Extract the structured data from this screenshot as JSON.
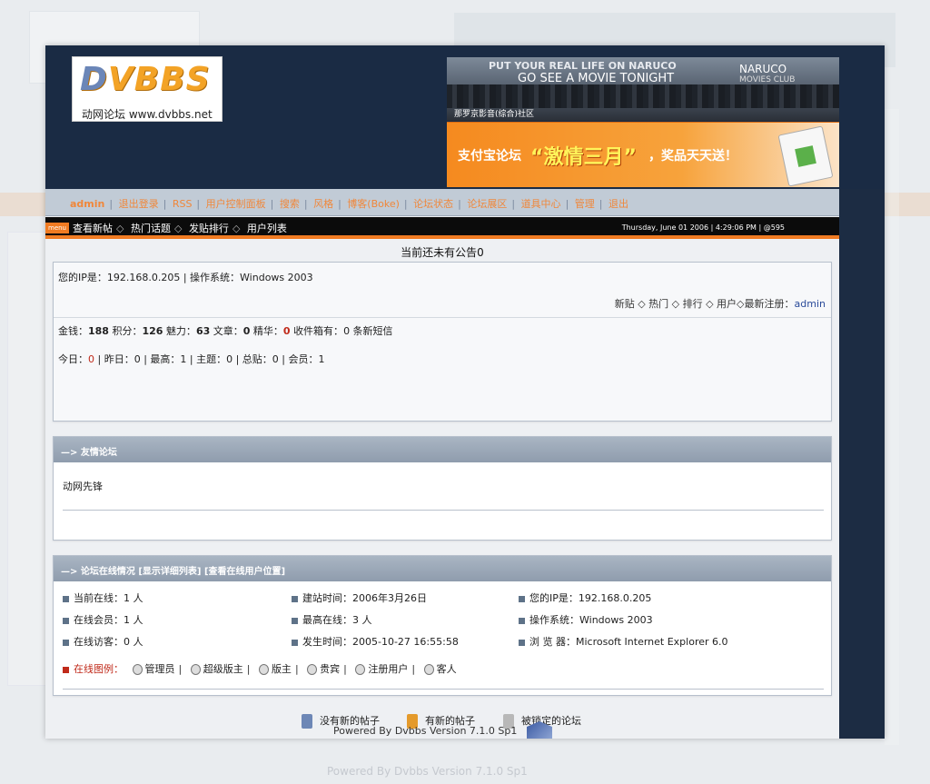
{
  "logo": {
    "mark_d": "D",
    "mark_rest": "VBBS",
    "caption": "动网论坛 www.dvbbs.net"
  },
  "banner_top": {
    "line1": "PUT YOUR REAL LIFE ON NARUCO",
    "line2": "GO SEE A MOVIE TONIGHT",
    "brand": "NARUCO",
    "brand_sub": "MOVIES CLUB",
    "community": "那罗京影音(综合)社区"
  },
  "banner_bottom": {
    "part1": "支付宝论坛",
    "part2": "“激情三月”",
    "part3": "，奖品天天送！"
  },
  "navbar1": {
    "items": [
      "admin",
      "退出登录",
      "RSS",
      "用户控制面板",
      "搜索",
      "风格",
      "博客(Boke)",
      "论坛状态",
      "论坛展区",
      "道具中心",
      "管理",
      "退出"
    ]
  },
  "navbar2": {
    "menu_tag": "menu",
    "links": [
      "查看新帖",
      "热门话题",
      "发贴排行",
      "用户列表"
    ],
    "date": "Thursday, June 01 2006 | 4:29:06 PM | @595"
  },
  "notice": "当前还未有公告0",
  "user_panel": {
    "ip_text": "您的IP是：192.168.0.205 | 操作系统：Windows 2003",
    "right_links": "新贴 ◇ 热门 ◇ 排行 ◇ 用户◇最新注册：",
    "latest_user": "admin",
    "money_label": "金钱：",
    "money": "188",
    "points_label": " 积分：",
    "points": "126",
    "charm_label": " 魅力：",
    "charm": "63",
    "posts_label": " 文章：",
    "posts": "0",
    "elite_label": " 精华：",
    "elite": "0",
    "inbox_label": " 收件箱有：",
    "inbox": "0",
    "inbox_suffix": " 条新短信",
    "today_label": "今日：",
    "today": "0",
    "stats_rest": " | 昨日：0 | 最高：1 | 主题：0 | 总贴：0 | 会员：1"
  },
  "links_panel": {
    "title": "—> 友情论坛",
    "body": "动网先锋"
  },
  "online_panel": {
    "title": "—> 论坛在线情况 [显示详细列表] [查看在线用户位置]",
    "col1": [
      "当前在线：1 人",
      "在线会员：1 人",
      "在线访客：0 人"
    ],
    "col2": [
      "建站时间：2006年3月26日",
      "最高在线：3 人",
      "发生时间：2005-10-27 16:55:58"
    ],
    "col3": [
      "您的IP是：192.168.0.205",
      "操作系统：Windows 2003",
      "浏 览 器：Microsoft Internet Explorer 6.0"
    ],
    "legend_label": "在线图例：",
    "legend_items": [
      "管理员",
      "超级版主",
      "版主",
      "贵宾",
      "注册用户",
      "客人"
    ]
  },
  "status_legend": [
    "没有新的帖子",
    "有新的帖子",
    "被锁定的论坛"
  ],
  "powered_by": "Powered By Dvbbs Version 7.1.0 Sp1",
  "bg_footer": "Powered By Dvbbs Version 7.1.0 Sp1"
}
